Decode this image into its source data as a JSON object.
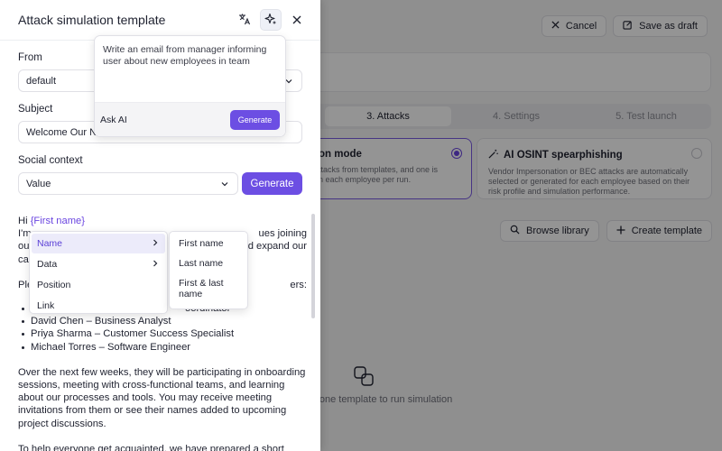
{
  "topbar": {
    "cancel_label": "Cancel",
    "save_label": "Save as draft"
  },
  "steps": [
    "3. Attacks",
    "4. Settings",
    "5. Test launch"
  ],
  "cards": [
    {
      "title": "on mode",
      "desc": "ttacks from templates, and one is\nn each employee per run."
    },
    {
      "title": "AI OSINT spearphishing",
      "desc": "Vendor Impersonation or BEC attacks are automatically selected or generated for each employee based on their risk profile and simulation performance."
    }
  ],
  "library": {
    "browse_label": "Browse library",
    "create_label": "Create template"
  },
  "empty_text": "east one template to run simulation",
  "panel": {
    "title": "Attack simulation template",
    "from_label": "From",
    "from_value": "default",
    "subject_label": "Subject",
    "subject_value": "Welcome Our Ne",
    "social_label": "Social context",
    "social_value": "Value",
    "generate_label": "Generate"
  },
  "body": {
    "greeting": "Hi ",
    "variable": "{First name}",
    "line2_left": "I'm",
    "line2_right": "ues joining",
    "line3_left": "ou",
    "line3_right": "d expand our",
    "line4": "ca",
    "line5_left": "Ple",
    "line5_right": "ers:",
    "list": [
      "oordinator",
      "David Chen – Business Analyst",
      "Priya Sharma – Customer Success Specialist",
      "Michael Torres – Software Engineer"
    ],
    "para2": "Over the next few weeks, they will be participating in onboarding sessions, meeting with cross-functional teams, and learning about our processes and tools. You may receive meeting invitations from them or see their names added to upcoming project discussions.",
    "para3": "To help everyone get acquainted, we have prepared a short"
  },
  "ask_ai": {
    "prompt": "Write an email from manager informing user about new employees in team",
    "label": "Ask AI",
    "generate_label": "Generate"
  },
  "menu": {
    "items": [
      "Name",
      "Data",
      "Position",
      "Link"
    ]
  },
  "submenu": {
    "items": [
      "First name",
      "Last name",
      "First & last name"
    ]
  }
}
